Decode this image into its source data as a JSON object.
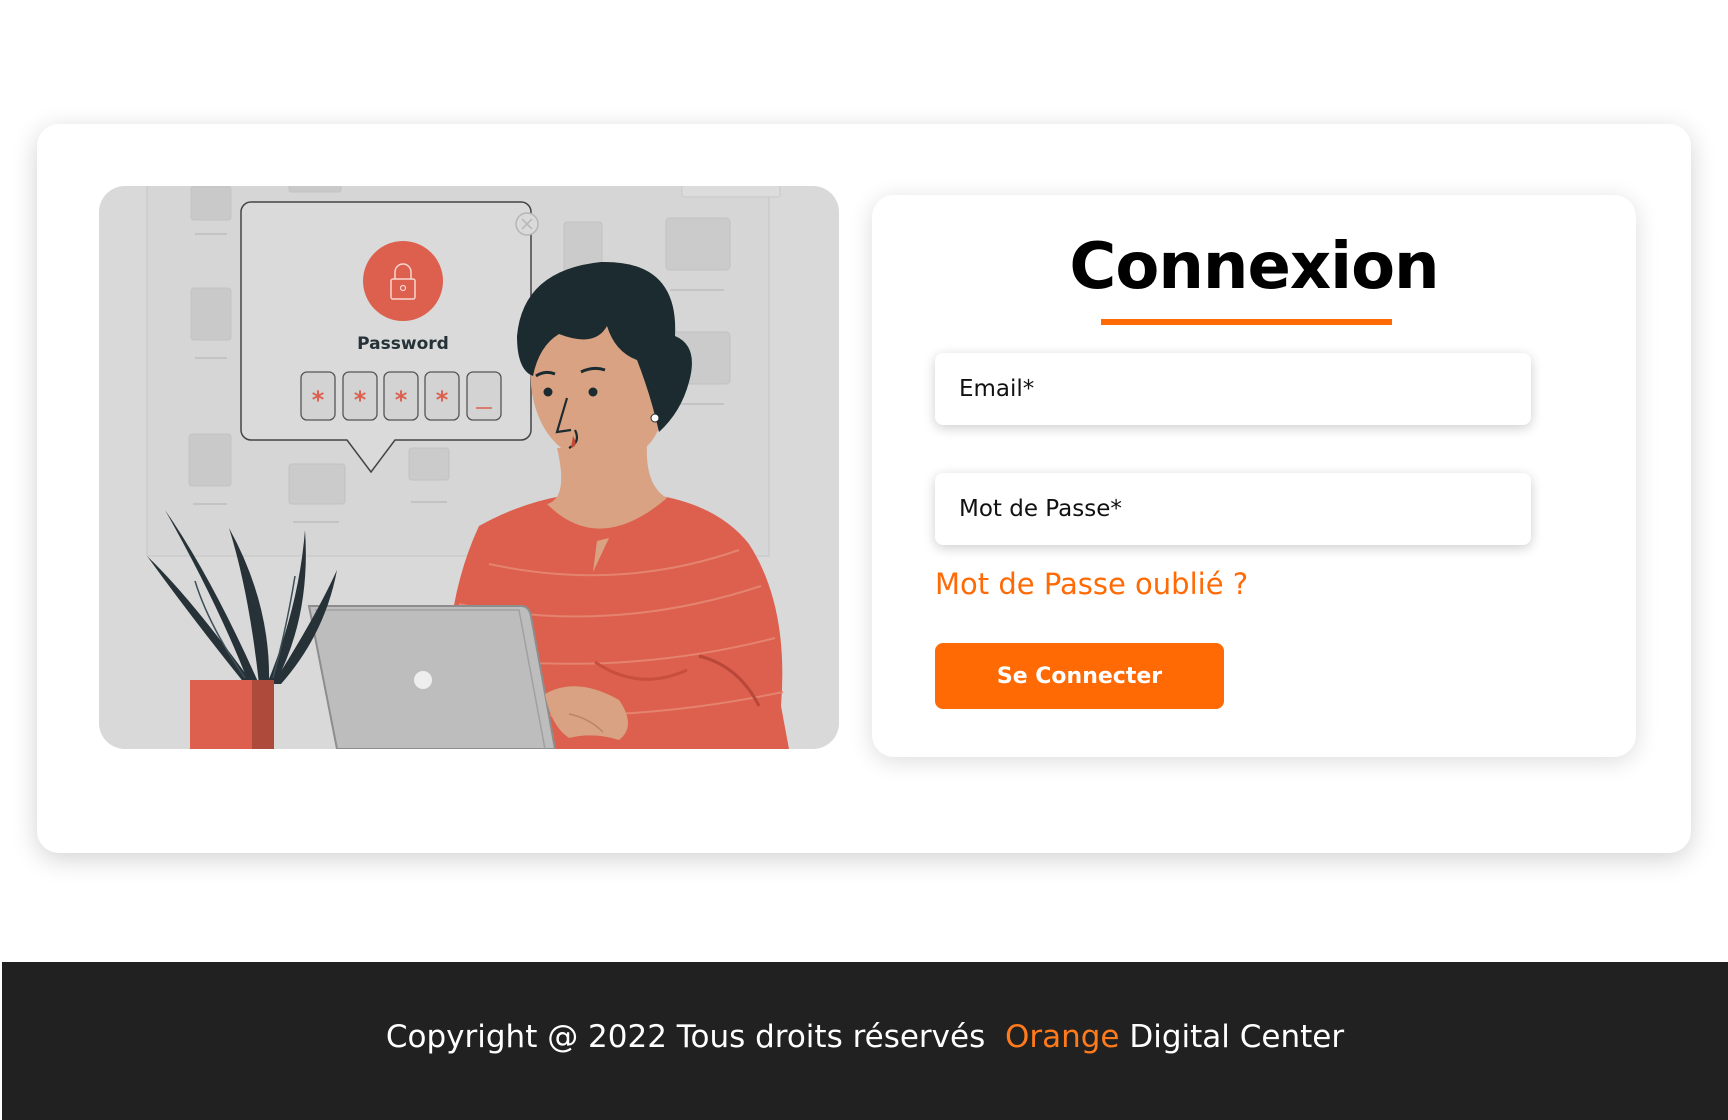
{
  "login": {
    "title": "Connexion",
    "email_placeholder": "Email*",
    "password_placeholder": "Mot de Passe*",
    "forgot_password": "Mot de Passe oublié ?",
    "submit_label": "Se Connecter"
  },
  "illustration": {
    "popup_label": "Password",
    "mask_char": "*"
  },
  "footer": {
    "copyright": "Copyright @ 2022 Tous droits réservés ",
    "brand": "Orange",
    "suffix": "Digital Center"
  },
  "colors": {
    "accent": "#ff6a05",
    "footer_background": "#212121",
    "illustration_background": "#d9d9d9",
    "illustration_accent": "#dc604d"
  }
}
